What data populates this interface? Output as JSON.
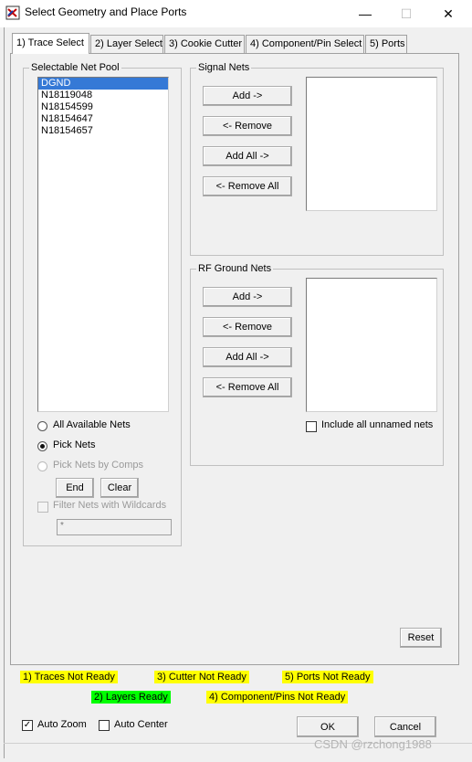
{
  "window": {
    "title": "Select Geometry and Place Ports",
    "minimize_glyph": "—",
    "maximize_glyph": "☐",
    "close_glyph": "✕"
  },
  "tabs": [
    {
      "label": "1) Trace Select",
      "active": true
    },
    {
      "label": "2) Layer Select",
      "active": false
    },
    {
      "label": "3) Cookie Cutter",
      "active": false
    },
    {
      "label": "4) Component/Pin Select",
      "active": false
    },
    {
      "label": "5) Ports",
      "active": false
    }
  ],
  "net_pool": {
    "label": "Selectable Net Pool",
    "items": [
      "DGND",
      "N18119048",
      "N18154599",
      "N18154647",
      "N18154657"
    ],
    "selected_index": 0,
    "options": {
      "all_available": "All Available Nets",
      "pick_nets": "Pick Nets",
      "pick_by_comps": "Pick Nets by Comps"
    },
    "end_button": "End",
    "clear_button": "Clear",
    "wildcard_label": "Filter Nets with Wildcards",
    "wildcard_value": "*"
  },
  "signal_nets": {
    "label": "Signal Nets",
    "add": "Add ->",
    "remove": "<- Remove",
    "add_all": "Add All ->",
    "remove_all": "<- Remove All"
  },
  "rf_ground_nets": {
    "label": "RF Ground Nets",
    "add": "Add ->",
    "remove": "<- Remove",
    "add_all": "Add All ->",
    "remove_all": "<- Remove All",
    "include_unnamed": "Include all unnamed nets"
  },
  "reset_button": "Reset",
  "status": {
    "traces": "1) Traces Not Ready",
    "cutter": "3) Cutter Not Ready",
    "ports": "5) Ports Not Ready",
    "layers": "2) Layers Ready",
    "components": "4) Component/Pins Not Ready"
  },
  "bottom": {
    "auto_zoom": "Auto Zoom",
    "auto_center": "Auto Center",
    "check_glyph": "✓",
    "ok": "OK",
    "cancel": "Cancel"
  },
  "watermark": "CSDN @rzchong1988",
  "colors": {
    "selection": "#3579d6",
    "status_not_ready": "#ffff00",
    "status_ready": "#00ff00"
  }
}
